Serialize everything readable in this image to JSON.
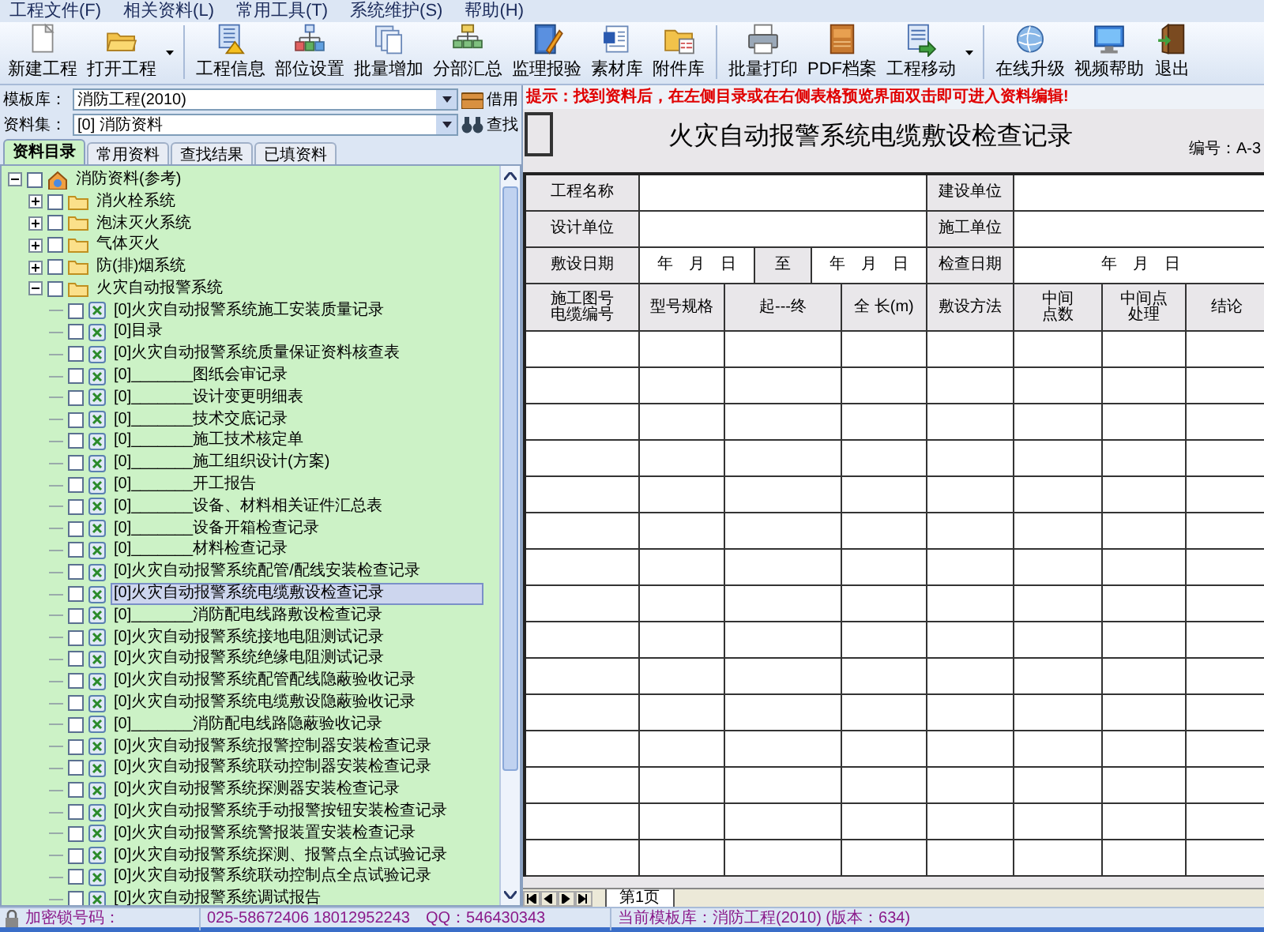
{
  "menu": [
    {
      "label": "工程文件(F)"
    },
    {
      "label": "相关资料(L)"
    },
    {
      "label": "常用工具(T)"
    },
    {
      "label": "系统维护(S)"
    },
    {
      "label": "帮助(H)"
    }
  ],
  "toolbar": [
    {
      "label": "新建工程",
      "dropdown": false,
      "separator_after": false
    },
    {
      "label": "打开工程",
      "dropdown": true,
      "separator_after": true
    },
    {
      "label": "工程信息",
      "dropdown": false,
      "separator_after": false
    },
    {
      "label": "部位设置",
      "dropdown": false,
      "separator_after": false
    },
    {
      "label": "批量增加",
      "dropdown": false,
      "separator_after": false
    },
    {
      "label": "分部汇总",
      "dropdown": false,
      "separator_after": false
    },
    {
      "label": "监理报验",
      "dropdown": false,
      "separator_after": false
    },
    {
      "label": "素材库",
      "dropdown": false,
      "separator_after": false
    },
    {
      "label": "附件库",
      "dropdown": false,
      "separator_after": true
    },
    {
      "label": "批量打印",
      "dropdown": false,
      "separator_after": false
    },
    {
      "label": "PDF档案",
      "dropdown": false,
      "separator_after": false
    },
    {
      "label": "工程移动",
      "dropdown": true,
      "separator_after": true
    },
    {
      "label": "在线升级",
      "dropdown": false,
      "separator_after": false
    },
    {
      "label": "视频帮助",
      "dropdown": false,
      "separator_after": false
    },
    {
      "label": "退出",
      "dropdown": false,
      "separator_after": false
    }
  ],
  "template_library": {
    "label": "模板库：",
    "value": "消防工程(2010)",
    "button": "借用"
  },
  "data_set": {
    "label": "资料集：",
    "value": "[0] 消防资料",
    "button": "查找"
  },
  "tabs": [
    {
      "label": "资料目录",
      "selected": true
    },
    {
      "label": "常用资料",
      "selected": false
    },
    {
      "label": "查找结果",
      "selected": false
    },
    {
      "label": "已填资料",
      "selected": false
    }
  ],
  "tree": [
    {
      "label": "消防资料(参考)",
      "expanded": true,
      "checked": false,
      "children": [
        {
          "label": "消火栓系统",
          "expanded": false,
          "checked": false
        },
        {
          "label": "泡沫灭火系统",
          "expanded": false,
          "checked": false
        },
        {
          "label": "气体灭火",
          "expanded": false,
          "checked": false
        },
        {
          "label": "防(排)烟系统",
          "expanded": false,
          "checked": false
        },
        {
          "label": "火灾自动报警系统",
          "expanded": true,
          "checked": false,
          "children": [
            {
              "label": "[0]火灾自动报警系统施工安装质量记录",
              "checked": false,
              "selected": false
            },
            {
              "label": "[0]目录",
              "checked": false,
              "selected": false
            },
            {
              "label": "[0]火灾自动报警系统质量保证资料核查表",
              "checked": false,
              "selected": false
            },
            {
              "label": "[0]_______图纸会审记录",
              "checked": false,
              "selected": false
            },
            {
              "label": "[0]_______设计变更明细表",
              "checked": false,
              "selected": false
            },
            {
              "label": "[0]_______技术交底记录",
              "checked": false,
              "selected": false
            },
            {
              "label": "[0]_______施工技术核定单",
              "checked": false,
              "selected": false
            },
            {
              "label": "[0]_______施工组织设计(方案)",
              "checked": false,
              "selected": false
            },
            {
              "label": "[0]_______开工报告",
              "checked": false,
              "selected": false
            },
            {
              "label": "[0]_______设备、材料相关证件汇总表",
              "checked": false,
              "selected": false
            },
            {
              "label": "[0]_______设备开箱检查记录",
              "checked": false,
              "selected": false
            },
            {
              "label": "[0]_______材料检查记录",
              "checked": false,
              "selected": false
            },
            {
              "label": "[0]火灾自动报警系统配管/配线安装检查记录",
              "checked": false,
              "selected": false
            },
            {
              "label": "[0]火灾自动报警系统电缆敷设检查记录",
              "checked": false,
              "selected": true
            },
            {
              "label": "[0]_______消防配电线路敷设检查记录",
              "checked": false,
              "selected": false
            },
            {
              "label": "[0]火灾自动报警系统接地电阻测试记录",
              "checked": false,
              "selected": false
            },
            {
              "label": "[0]火灾自动报警系统绝缘电阻测试记录",
              "checked": false,
              "selected": false
            },
            {
              "label": "[0]火灾自动报警系统配管配线隐蔽验收记录",
              "checked": false,
              "selected": false
            },
            {
              "label": "[0]火灾自动报警系统电缆敷设隐蔽验收记录",
              "checked": false,
              "selected": false
            },
            {
              "label": "[0]_______消防配电线路隐蔽验收记录",
              "checked": false,
              "selected": false
            },
            {
              "label": "[0]火灾自动报警系统报警控制器安装检查记录",
              "checked": false,
              "selected": false
            },
            {
              "label": "[0]火灾自动报警系统联动控制器安装检查记录",
              "checked": false,
              "selected": false
            },
            {
              "label": "[0]火灾自动报警系统探测器安装检查记录",
              "checked": false,
              "selected": false
            },
            {
              "label": "[0]火灾自动报警系统手动报警按钮安装检查记录",
              "checked": false,
              "selected": false
            },
            {
              "label": "[0]火灾自动报警系统警报装置安装检查记录",
              "checked": false,
              "selected": false
            },
            {
              "label": "[0]火灾自动报警系统探测、报警点全点试验记录",
              "checked": false,
              "selected": false
            },
            {
              "label": "[0]火灾自动报警系统联动控制点全点试验记录",
              "checked": false,
              "selected": false
            },
            {
              "label": "[0]火灾自动报警系统调试报告",
              "checked": false,
              "selected": false
            }
          ]
        }
      ]
    }
  ],
  "hint": "提示：找到资料后，在左侧目录或在右侧表格预览界面双击即可进入资料编辑!",
  "sheet": {
    "title": "火灾自动报警系统电缆敷设检查记录",
    "number": "编号：A-3",
    "info_rows": [
      [
        "工程名称",
        "建设单位"
      ],
      [
        "设计单位",
        "施工单位"
      ]
    ],
    "date_row": {
      "label": "敷设日期",
      "from": "年　月　日",
      "to_label": "至",
      "to": "年　月　日",
      "check_label": "检查日期",
      "check": "年　月　日"
    },
    "columns": [
      "施工图号电缆编号",
      "型号规格",
      "起---终",
      "全 长(m)",
      "敷设方法",
      "中间点数",
      "中间点处理",
      "结论"
    ]
  },
  "sheet_tabs": [
    {
      "label": "第1页",
      "selected": true
    }
  ],
  "status_bar": {
    "lock_label": "加密锁号码：",
    "contact": "025-58672406 18012952243　QQ：546430343",
    "template": "当前模板库：消防工程(2010) (版本：634)"
  }
}
